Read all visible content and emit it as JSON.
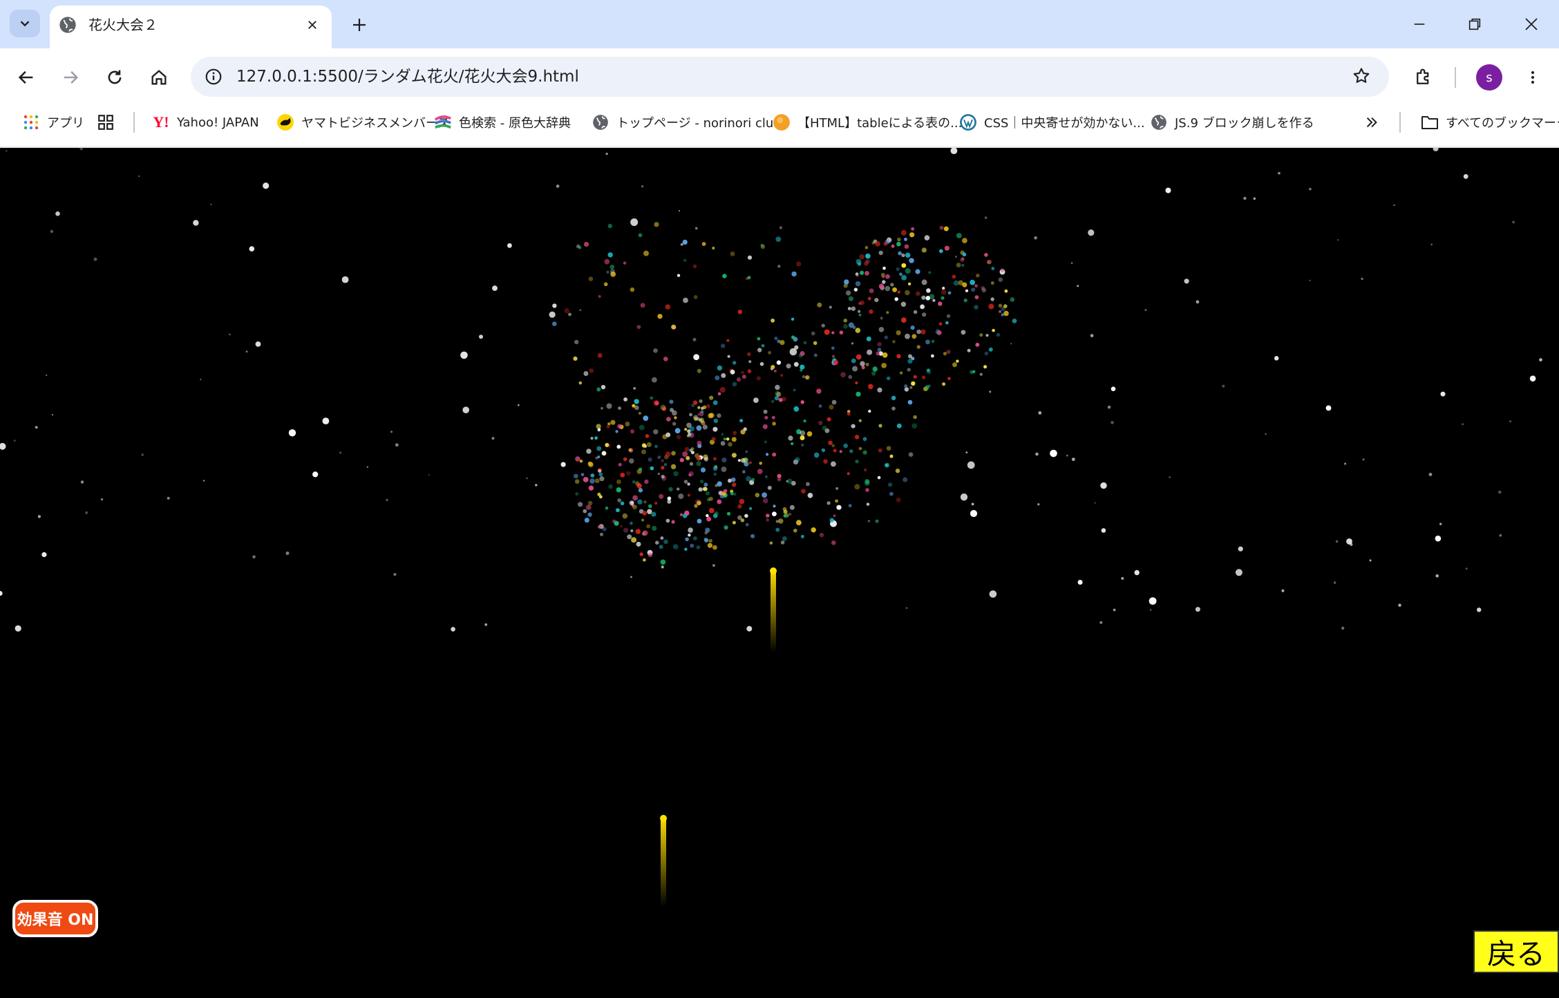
{
  "tab": {
    "title": "花火大会２"
  },
  "address": {
    "url": "127.0.0.1:5500/ランダム花火/花火大会9.html"
  },
  "profile": {
    "initial": "s",
    "color": "#7b1fa2"
  },
  "bookmarks": [
    {
      "label": "アプリ",
      "icon": "apps-grid-icon"
    },
    {
      "label": "",
      "icon": "tab-groups-icon"
    },
    {
      "label": "Yahoo! JAPAN",
      "icon": "yahoo-icon"
    },
    {
      "label": "ヤマトビジネスメンバーズ",
      "icon": "yamato-icon"
    },
    {
      "label": "色検索 - 原色大辞典",
      "icon": "color-dictionary-icon"
    },
    {
      "label": "トップページ - norinori club",
      "icon": "globe-icon"
    },
    {
      "label": "【HTML】tableによる表の...",
      "icon": "orange-circle-icon"
    },
    {
      "label": "CSS｜中央寄せが効かない...",
      "icon": "wordpress-icon"
    },
    {
      "label": "JS.9 ブロック崩しを作る",
      "icon": "globe-icon"
    },
    {
      "label": "すべてのブックマーク",
      "icon": "folder-icon"
    }
  ],
  "page": {
    "sound_button": "効果音 ON",
    "back_button": "戻る"
  },
  "colors": {
    "tab_strip": "#d3e3fd",
    "sound_button": "#ee4a12",
    "back_button": "#ffff1a",
    "spark_palette": [
      "#ffffff",
      "#1fb5c4",
      "#e0b81a",
      "#e04a8a",
      "#18b06a",
      "#d8261e",
      "#c8c8c8",
      "#f0e040",
      "#5aa0e0"
    ]
  }
}
